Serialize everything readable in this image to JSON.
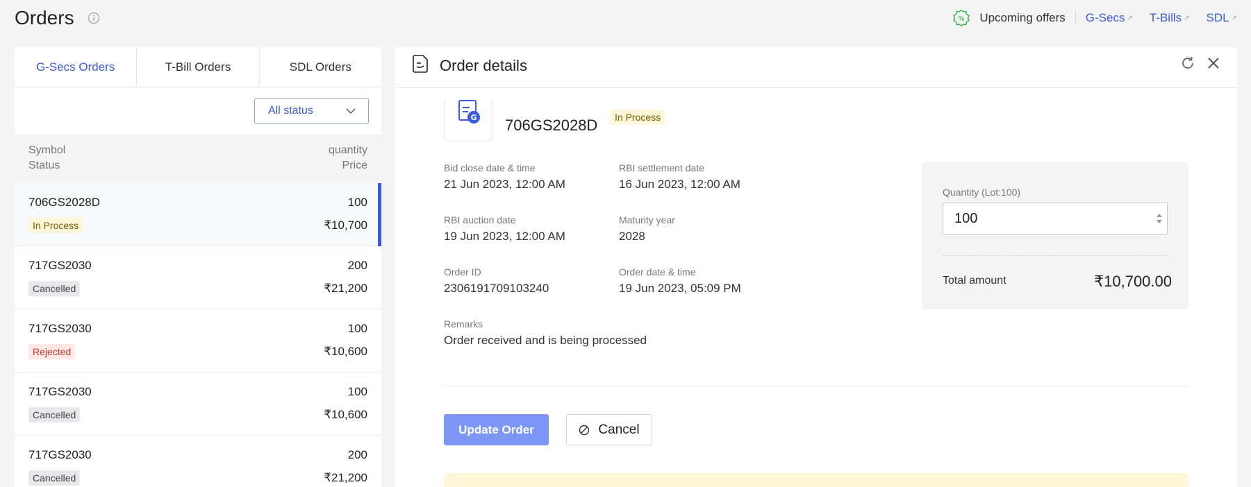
{
  "page": {
    "title": "Orders"
  },
  "offers": {
    "label": "Upcoming offers",
    "links": [
      {
        "label": "G-Secs"
      },
      {
        "label": "T-Bills"
      },
      {
        "label": "SDL"
      }
    ],
    "ext_glyph": "↗"
  },
  "tabs": [
    {
      "label": "G-Secs Orders",
      "active": true
    },
    {
      "label": "T-Bill Orders",
      "active": false
    },
    {
      "label": "SDL Orders",
      "active": false
    }
  ],
  "filter": {
    "selected": "All status"
  },
  "list_header": {
    "left_line1": "Symbol",
    "left_line2": "Status",
    "right_line1": "quantity",
    "right_line2": "Price"
  },
  "orders": [
    {
      "symbol": "706GS2028D",
      "status": "In Process",
      "quantity": "100",
      "price": "₹10,700"
    },
    {
      "symbol": "717GS2030",
      "status": "Cancelled",
      "quantity": "200",
      "price": "₹21,200"
    },
    {
      "symbol": "717GS2030",
      "status": "Rejected",
      "quantity": "100",
      "price": "₹10,600"
    },
    {
      "symbol": "717GS2030",
      "status": "Cancelled",
      "quantity": "100",
      "price": "₹10,600"
    },
    {
      "symbol": "717GS2030",
      "status": "Cancelled",
      "quantity": "200",
      "price": "₹21,200"
    }
  ],
  "detail": {
    "title": "Order details",
    "security": {
      "name": "706GS2028D",
      "status": "In Process"
    },
    "fields": {
      "bid_close": {
        "label": "Bid close date & time",
        "value": "21 Jun 2023, 12:00 AM"
      },
      "rbi_settlement": {
        "label": "RBI settlement date",
        "value": "16 Jun 2023, 12:00 AM"
      },
      "rbi_auction": {
        "label": "RBI auction date",
        "value": "19 Jun 2023, 12:00 AM"
      },
      "maturity_year": {
        "label": "Maturity year",
        "value": "2028"
      },
      "order_id": {
        "label": "Order ID",
        "value": "2306191709103240"
      },
      "order_date": {
        "label": "Order date & time",
        "value": "19 Jun 2023, 05:09 PM"
      },
      "remarks": {
        "label": "Remarks",
        "value": "Order received and is being processed"
      }
    },
    "quantity_card": {
      "label": "Quantity (Lot:100)",
      "value": "100",
      "total_label": "Total amount",
      "total_value": "₹10,700.00"
    },
    "buttons": {
      "update": "Update Order",
      "cancel": "Cancel"
    }
  },
  "colors": {
    "accent": "#3b5bdb",
    "update_button": "#7d96f5",
    "in_process_bg": "#fdf6d8",
    "rejected_text": "#c0392b"
  }
}
